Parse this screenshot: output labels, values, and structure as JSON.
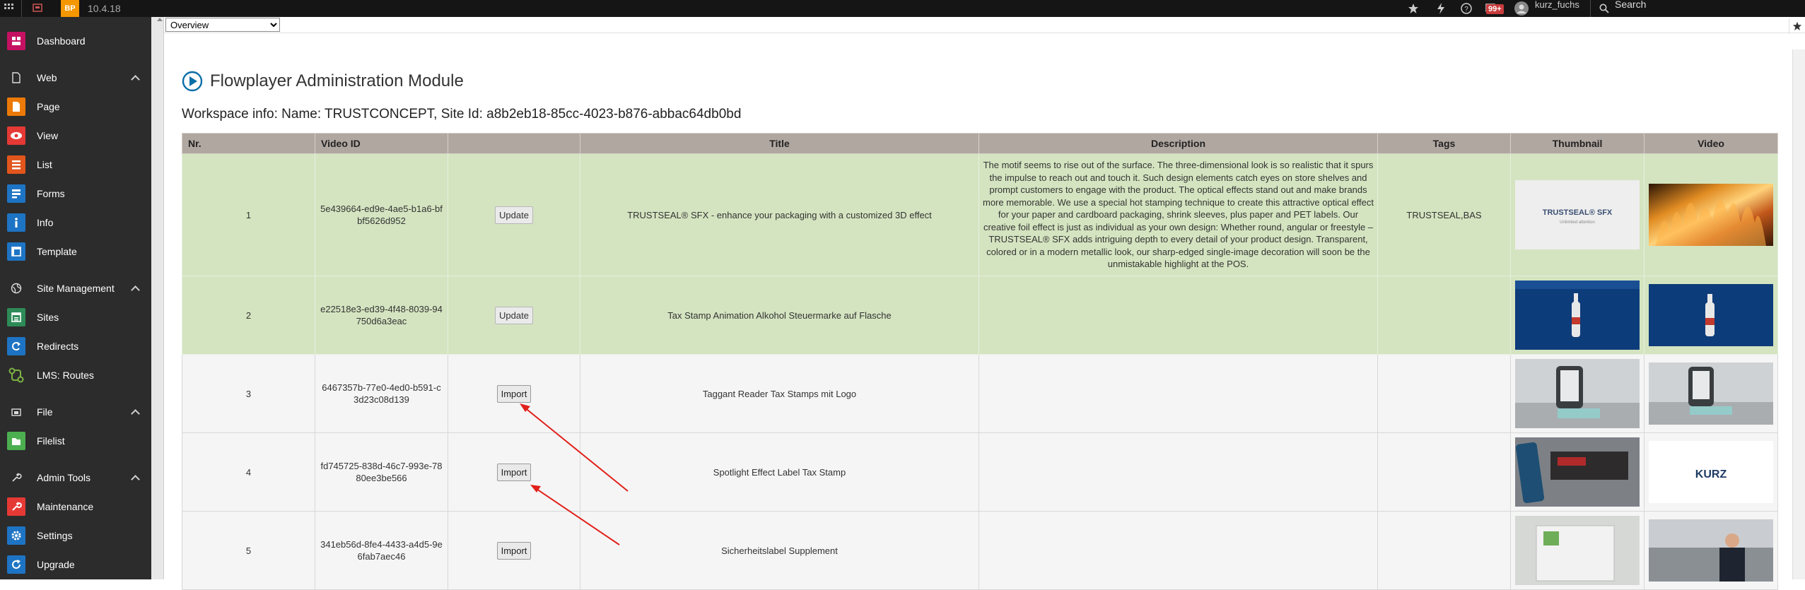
{
  "topbar": {
    "version": "10.4.18",
    "logo_text": "BP",
    "notification_count": "99+",
    "username": "kurz_fuchs",
    "search_label": "Search"
  },
  "sidebar": {
    "items": [
      {
        "label": "Dashboard",
        "icon": "dashboard-icon",
        "color": "#c51162",
        "type": "item"
      },
      {
        "label": "Web",
        "icon": "file-icon",
        "type": "group"
      },
      {
        "label": "Page",
        "icon": "page-icon",
        "color": "#ec7a08",
        "type": "item"
      },
      {
        "label": "View",
        "icon": "eye-icon",
        "color": "#e53935",
        "type": "item"
      },
      {
        "label": "List",
        "icon": "list-icon",
        "color": "#e2561d",
        "type": "item"
      },
      {
        "label": "Forms",
        "icon": "forms-icon",
        "color": "#1e74c4",
        "type": "item"
      },
      {
        "label": "Info",
        "icon": "info-icon",
        "color": "#1e74c4",
        "type": "item"
      },
      {
        "label": "Template",
        "icon": "template-icon",
        "color": "#1e74c4",
        "type": "item"
      },
      {
        "label": "Site Management",
        "icon": "globe-icon",
        "type": "group"
      },
      {
        "label": "Sites",
        "icon": "sites-icon",
        "color": "#2e8b57",
        "type": "item"
      },
      {
        "label": "Redirects",
        "icon": "redirects-icon",
        "color": "#1e74c4",
        "type": "item"
      },
      {
        "label": "LMS: Routes",
        "icon": "routes-icon",
        "color": "#7cb342",
        "type": "item"
      },
      {
        "label": "File",
        "icon": "file-group-icon",
        "type": "group"
      },
      {
        "label": "Filelist",
        "icon": "filelist-icon",
        "color": "#4caf50",
        "type": "item"
      },
      {
        "label": "Admin Tools",
        "icon": "tools-icon",
        "type": "group"
      },
      {
        "label": "Maintenance",
        "icon": "maintenance-icon",
        "color": "#e53935",
        "type": "item"
      },
      {
        "label": "Settings",
        "icon": "settings-icon",
        "color": "#1e74c4",
        "type": "item"
      },
      {
        "label": "Upgrade",
        "icon": "upgrade-icon",
        "color": "#1e74c4",
        "type": "item"
      }
    ]
  },
  "docheader": {
    "select_value": "Overview"
  },
  "module": {
    "title": "Flowplayer Administration Module",
    "workspace_info": "Workspace info: Name: TRUSTCONCEPT, Site Id: a8b2eb18-85cc-4023-b876-abbac64db0bd"
  },
  "table": {
    "headers": [
      "Nr.",
      "Video ID",
      "",
      "Title",
      "Description",
      "Tags",
      "Thumbnail",
      "Video"
    ],
    "rows": [
      {
        "nr": "1",
        "video_id": "5e439664-ed9e-4ae5-b1a6-bfbf5626d952",
        "action": "Update",
        "title": "TRUSTSEAL® SFX - enhance your packaging with a customized 3D effect",
        "description": "The motif seems to rise out of the surface. The three-dimensional look is so realistic that it spurs the impulse to reach out and touch it. Such design elements catch eyes on store shelves and prompt customers to engage with the product. The optical effects stand out and make brands more memorable. We use a special hot stamping technique to create this attractive optical effect for your paper and cardboard packaging, shrink sleeves, plus paper and PET labels. Our creative foil effect is just as individual as your own design: Whether round, angular or freestyle – TRUSTSEAL® SFX adds intriguing depth to every detail of your product design. Transparent, colored or in a modern metallic look, our sharp-edged single-image decoration will soon be the unmistakable highlight at the POS.",
        "tags": "TRUSTSEAL,BAS",
        "thumb_text": "TRUSTSEAL® SFX",
        "thumb_sub": "Unlimited attention",
        "status": "synced"
      },
      {
        "nr": "2",
        "video_id": "e22518e3-ed39-4f48-8039-94750d6a3eac",
        "action": "Update",
        "title": "Tax Stamp Animation Alkohol Steuermarke auf Flasche",
        "description": "",
        "tags": "",
        "status": "synced"
      },
      {
        "nr": "3",
        "video_id": "6467357b-77e0-4ed0-b591-c3d23c08d139",
        "action": "Import",
        "title": "Taggant Reader Tax Stamps mit Logo",
        "description": "",
        "tags": "",
        "status": "new"
      },
      {
        "nr": "4",
        "video_id": "fd745725-838d-46c7-993e-7880ee3be566",
        "action": "Import",
        "title": "Spotlight Effect Label Tax Stamp",
        "description": "",
        "tags": "",
        "video_text": "KURZ",
        "status": "new"
      },
      {
        "nr": "5",
        "video_id": "341eb56d-8fe4-4433-a4d5-9e6fab7aec46",
        "action": "Import",
        "title": "Sicherheitslabel Supplement",
        "description": "",
        "tags": "",
        "status": "new"
      }
    ]
  },
  "colors": {
    "synced_row": "#d4e4c0",
    "header_bg": "#b0a7a1",
    "sidebar_bg": "#2c2c2c",
    "accent_blue": "#0b6ea8",
    "annotation_arrow": "#e0201a"
  }
}
